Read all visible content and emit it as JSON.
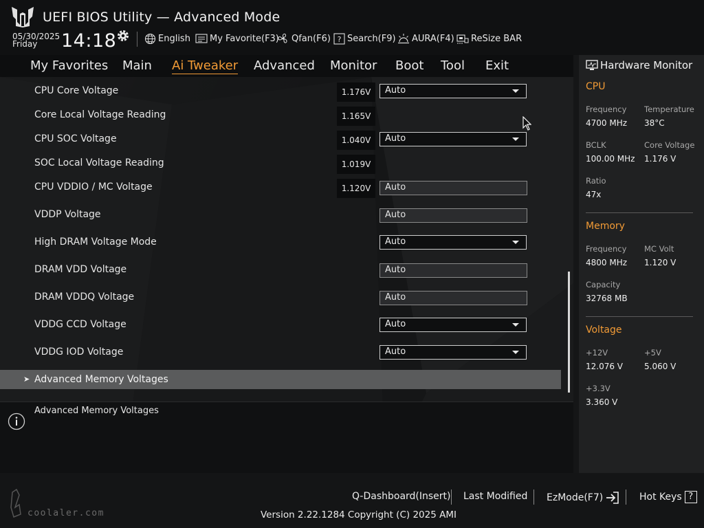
{
  "header": {
    "title": "UEFI BIOS Utility — Advanced Mode",
    "date": "05/30/2025",
    "day": "Friday",
    "time": "14:18",
    "tools": [
      {
        "label": "English",
        "icon": "globe-icon"
      },
      {
        "label": "My Favorite(F3)",
        "icon": "favorite-icon"
      },
      {
        "label": "Qfan(F6)",
        "icon": "fan-icon"
      },
      {
        "label": "Search(F9)",
        "icon": "search-help-icon"
      },
      {
        "label": "AURA(F4)",
        "icon": "aura-icon"
      },
      {
        "label": "ReSize BAR",
        "icon": "resize-bar-icon"
      }
    ]
  },
  "nav": {
    "tabs": [
      {
        "label": "My Favorites"
      },
      {
        "label": "Main"
      },
      {
        "label": "Ai Tweaker",
        "active": true
      },
      {
        "label": "Advanced"
      },
      {
        "label": "Monitor"
      },
      {
        "label": "Boot"
      },
      {
        "label": "Tool"
      },
      {
        "label": "Exit"
      }
    ]
  },
  "settings": [
    {
      "label": "CPU Core Voltage",
      "reading": "1.176V",
      "value": "Auto",
      "control": "dropdown"
    },
    {
      "label": "Core Local Voltage Reading",
      "reading": "1.165V",
      "control": "none"
    },
    {
      "label": "CPU SOC Voltage",
      "reading": "1.040V",
      "value": "Auto",
      "control": "dropdown"
    },
    {
      "label": "SOC Local Voltage Reading",
      "reading": "1.019V",
      "control": "none"
    },
    {
      "label": "CPU VDDIO / MC Voltage",
      "reading": "1.120V",
      "value": "Auto",
      "control": "field"
    },
    {
      "label": "VDDP Voltage",
      "value": "Auto",
      "control": "field"
    },
    {
      "label": "High DRAM Voltage Mode",
      "value": "Auto",
      "control": "dropdown"
    },
    {
      "label": "DRAM VDD Voltage",
      "value": "Auto",
      "control": "field"
    },
    {
      "label": "DRAM VDDQ Voltage",
      "value": "Auto",
      "control": "field"
    },
    {
      "label": "VDDG CCD Voltage",
      "value": "Auto",
      "control": "dropdown"
    },
    {
      "label": "VDDG IOD Voltage",
      "value": "Auto",
      "control": "dropdown"
    }
  ],
  "submenu": {
    "label": "Advanced Memory Voltages"
  },
  "help": {
    "text": "Advanced Memory Voltages"
  },
  "hardware_monitor": {
    "title": "Hardware Monitor",
    "cpu": {
      "title": "CPU",
      "frequency_label": "Frequency",
      "frequency": "4700 MHz",
      "temperature_label": "Temperature",
      "temperature": "38°C",
      "bclk_label": "BCLK",
      "bclk": "100.00 MHz",
      "core_voltage_label": "Core Voltage",
      "core_voltage": "1.176 V",
      "ratio_label": "Ratio",
      "ratio": "47x"
    },
    "memory": {
      "title": "Memory",
      "frequency_label": "Frequency",
      "frequency": "4800 MHz",
      "mc_volt_label": "MC Volt",
      "mc_volt": "1.120 V",
      "capacity_label": "Capacity",
      "capacity": "32768 MB"
    },
    "voltage": {
      "title": "Voltage",
      "v12_label": "+12V",
      "v12": "12.076 V",
      "v5_label": "+5V",
      "v5": "5.060 V",
      "v33_label": "+3.3V",
      "v33": "3.360 V"
    }
  },
  "footer": {
    "qdashboard": "Q-Dashboard(Insert)",
    "last_modified": "Last Modified",
    "ezmode": "EzMode(F7)",
    "hotkeys": "Hot Keys",
    "hotkeys_key": "?",
    "version": "Version 2.22.1284 Copyright (C) 2025 AMI"
  },
  "watermark": {
    "text": "coolaler.com"
  },
  "colors": {
    "accent": "#f29b36",
    "selected_row": "#5a5b5c",
    "panel": "#202122"
  }
}
